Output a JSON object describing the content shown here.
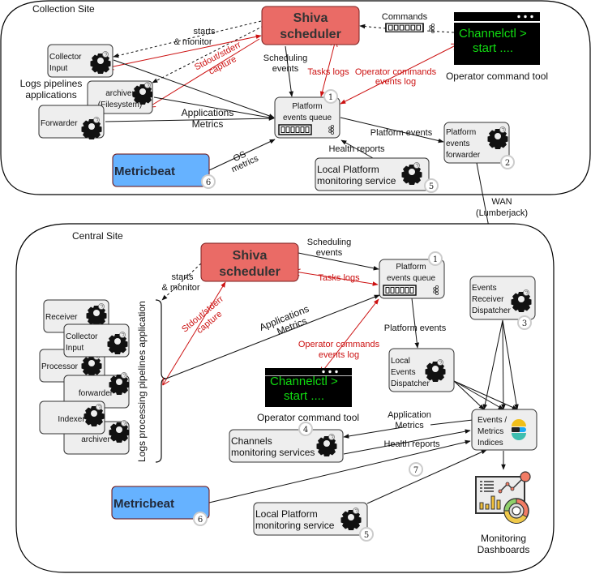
{
  "collection_site": {
    "title": "Collection Site",
    "pipelines_label_line1": "Logs pipelines",
    "pipelines_label_line2": "applications",
    "collector_input": {
      "line1": "Collector",
      "line2": "Input"
    },
    "archiver": {
      "line1": "archiver",
      "line2": "(Filesystem)"
    },
    "forwarder": {
      "label": "Forwarder"
    },
    "scheduler": {
      "line1": "Shiva",
      "line2": "scheduler"
    },
    "queue": {
      "line1": "Platform",
      "line2": "events queue",
      "badge": "1"
    },
    "platform_forwarder": {
      "line1": "Platform",
      "line2": "events",
      "line3": "forwarder",
      "badge": "2"
    },
    "metricbeat": {
      "label": "Metricbeat",
      "badge": "6"
    },
    "local_monitoring": {
      "line1": "Local Platform",
      "line2": "monitoring service",
      "badge": "5"
    },
    "terminal": {
      "line1": "Channelctl >",
      "line2": "start ....",
      "caption": "Operator command tool"
    },
    "edges": {
      "starts_line1": "starts",
      "starts_line2": "& monitor",
      "stdout_line1": "Stdout/stderr",
      "stdout_line2": "capture",
      "scheduling_line1": "Scheduling",
      "scheduling_line2": "events",
      "tasks_logs": "Tasks logs",
      "operator_line1": "Operator commands",
      "operator_line2": "events log",
      "commands": "Commands",
      "app_metrics_line1": "Applications",
      "app_metrics_line2": "Metrics",
      "os_line1": "OS",
      "os_line2": "metrics",
      "platform_events": "Platform events",
      "health_reports": "Health reports"
    }
  },
  "wan": {
    "line1": "WAN",
    "line2": "(Lumberjack)"
  },
  "central_site": {
    "title": "Central Site",
    "pipelines_vertical_label": "Logs processing pipelines application",
    "apps": [
      "Receiver",
      "Collector Input",
      "Processor",
      "forwarder",
      "Indexer",
      "archiver"
    ],
    "collector_input": {
      "line1": "Collector",
      "line2": "Input"
    },
    "scheduler": {
      "line1": "Shiva",
      "line2": "scheduler"
    },
    "queue": {
      "line1": "Platform",
      "line2": "events queue",
      "badge": "1"
    },
    "receiver_dispatcher": {
      "line1": "Events",
      "line2": "Receiver",
      "line3": "Dispatcher",
      "badge": "3"
    },
    "local_dispatcher": {
      "line1": "Local",
      "line2": "Events",
      "line3": "Dispatcher"
    },
    "indices": {
      "line1": "Events /",
      "line2": "Metrics",
      "line3": "Indices"
    },
    "channels_monitoring": {
      "line1": "Channels",
      "line2": "monitoring services",
      "badge": "4"
    },
    "metricbeat": {
      "label": "Metricbeat",
      "badge": "6"
    },
    "local_monitoring": {
      "line1": "Local Platform",
      "line2": "monitoring service",
      "badge": "5"
    },
    "dashboards": {
      "line1": "Monitoring",
      "line2": "Dashboards"
    },
    "terminal": {
      "line1": "Channelctl >",
      "line2": "start ....",
      "caption": "Operator command tool"
    },
    "edge7_badge": "7",
    "edges": {
      "starts_line1": "starts",
      "starts_line2": "& monitor",
      "stdout_line1": "Stdout/stderr",
      "stdout_line2": "capture",
      "scheduling_line1": "Scheduling",
      "scheduling_line2": "events",
      "tasks_logs": "Tasks logs",
      "app_metrics_line1": "Applications",
      "app_metrics_line2": "Metrics",
      "operator_line1": "Operator commands",
      "operator_line2": "events log",
      "platform_events": "Platform events",
      "application_metrics_line1": "Application",
      "application_metrics_line2": "Metrics",
      "health_reports": "Health reports"
    }
  },
  "colors": {
    "scheduler": "#ea6b66",
    "metricbeat": "#66b2ff",
    "node": "#eeeeee",
    "red_edge": "#cc1111",
    "terminal_text": "#11dd11"
  }
}
